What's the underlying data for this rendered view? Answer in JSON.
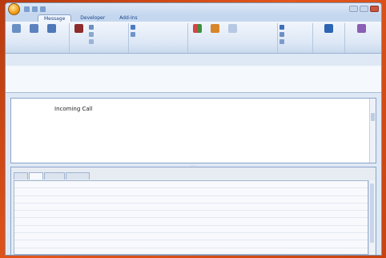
{
  "window": {
    "title": ""
  },
  "ribbon": {
    "tabs": [
      "Message",
      "Developer",
      "Add-Ins"
    ],
    "groups": [
      {
        "label": "",
        "icon_color": "#6a8fc6"
      },
      {
        "label": "",
        "icon_color": "#8e2b2b"
      },
      {
        "label": "",
        "icon_color": "#4b7bc4"
      },
      {
        "label": "",
        "icon_color": "#d8862a"
      },
      {
        "label": "",
        "icon_color": "#3f6fb8"
      },
      {
        "label": "",
        "icon_color": "#2d64b3"
      },
      {
        "label": "",
        "icon_color": "#8a5fb4"
      }
    ]
  },
  "header": {
    "rows": [
      {
        "label": "",
        "value": ""
      },
      {
        "label": "",
        "value": ""
      },
      {
        "label": "",
        "value": ""
      },
      {
        "label": "",
        "value": ""
      }
    ]
  },
  "message": {
    "title": "Incoming Call",
    "lines": [
      "",
      "",
      "",
      ""
    ]
  },
  "lower_pane": {
    "title": "",
    "tabs": [
      "",
      "",
      "",
      ""
    ],
    "rows": [
      [
        [
          "",
          ""
        ],
        [
          "",
          ""
        ],
        [
          "",
          ""
        ]
      ],
      [
        [
          "",
          ""
        ],
        [
          "",
          ""
        ],
        [
          "",
          ""
        ]
      ],
      [
        [
          "",
          ""
        ],
        [
          "",
          ""
        ],
        [
          "",
          ""
        ]
      ],
      [
        [
          "",
          ""
        ],
        [
          "",
          ""
        ],
        [
          "",
          ""
        ]
      ],
      [
        [
          "",
          ""
        ],
        [
          "",
          ""
        ],
        [
          "",
          ""
        ]
      ],
      [
        [
          "",
          ""
        ],
        [
          "",
          ""
        ],
        [
          "",
          ""
        ]
      ],
      [
        [
          "",
          ""
        ],
        [
          "",
          ""
        ],
        [
          "",
          ""
        ]
      ],
      [
        [
          "",
          ""
        ],
        [
          "",
          ""
        ],
        [
          "",
          ""
        ]
      ],
      [
        [
          "",
          ""
        ],
        [
          "",
          ""
        ],
        [
          "",
          ""
        ]
      ],
      [
        [
          "",
          ""
        ],
        [
          "",
          ""
        ],
        [
          "",
          ""
        ]
      ]
    ]
  }
}
